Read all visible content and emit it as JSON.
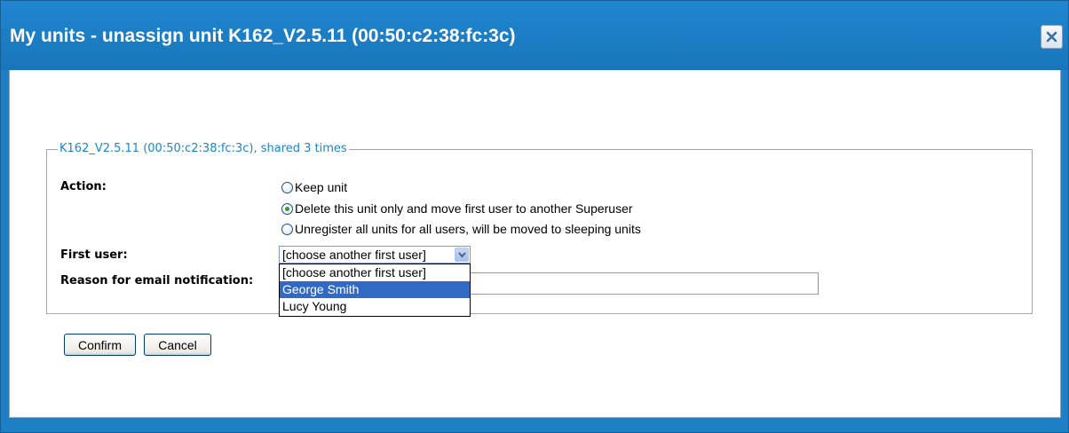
{
  "dialog": {
    "title": "My units - unassign unit K162_V2.5.11 (00:50:c2:38:fc:3c)",
    "close_icon": "close-icon"
  },
  "fieldset": {
    "legend": "K162_V2.5.11 (00:50:c2:38:fc:3c), shared 3 times"
  },
  "action": {
    "label": "Action:",
    "options": [
      {
        "label": "Keep unit",
        "checked": false
      },
      {
        "label": "Delete this unit only and move first user to another Superuser",
        "checked": true
      },
      {
        "label": "Unregister all units for all users, will be moved to sleeping units",
        "checked": false
      }
    ]
  },
  "first_user": {
    "label": "First user:",
    "selected_value": "[choose another first user]",
    "options": [
      {
        "label": "[choose another first user]",
        "highlighted": false
      },
      {
        "label": "George Smith",
        "highlighted": true
      },
      {
        "label": "Lucy Young",
        "highlighted": false
      }
    ],
    "arrow_icon": "chevron-down-icon"
  },
  "reason": {
    "label": "Reason for email notification:",
    "value": ""
  },
  "buttons": {
    "confirm": "Confirm",
    "cancel": "Cancel"
  },
  "colors": {
    "title_bar": "#1e7fc4",
    "legend_text": "#1e85c7",
    "selection_highlight": "#316ac5",
    "radio_checked_dot": "#3a9a2d"
  }
}
